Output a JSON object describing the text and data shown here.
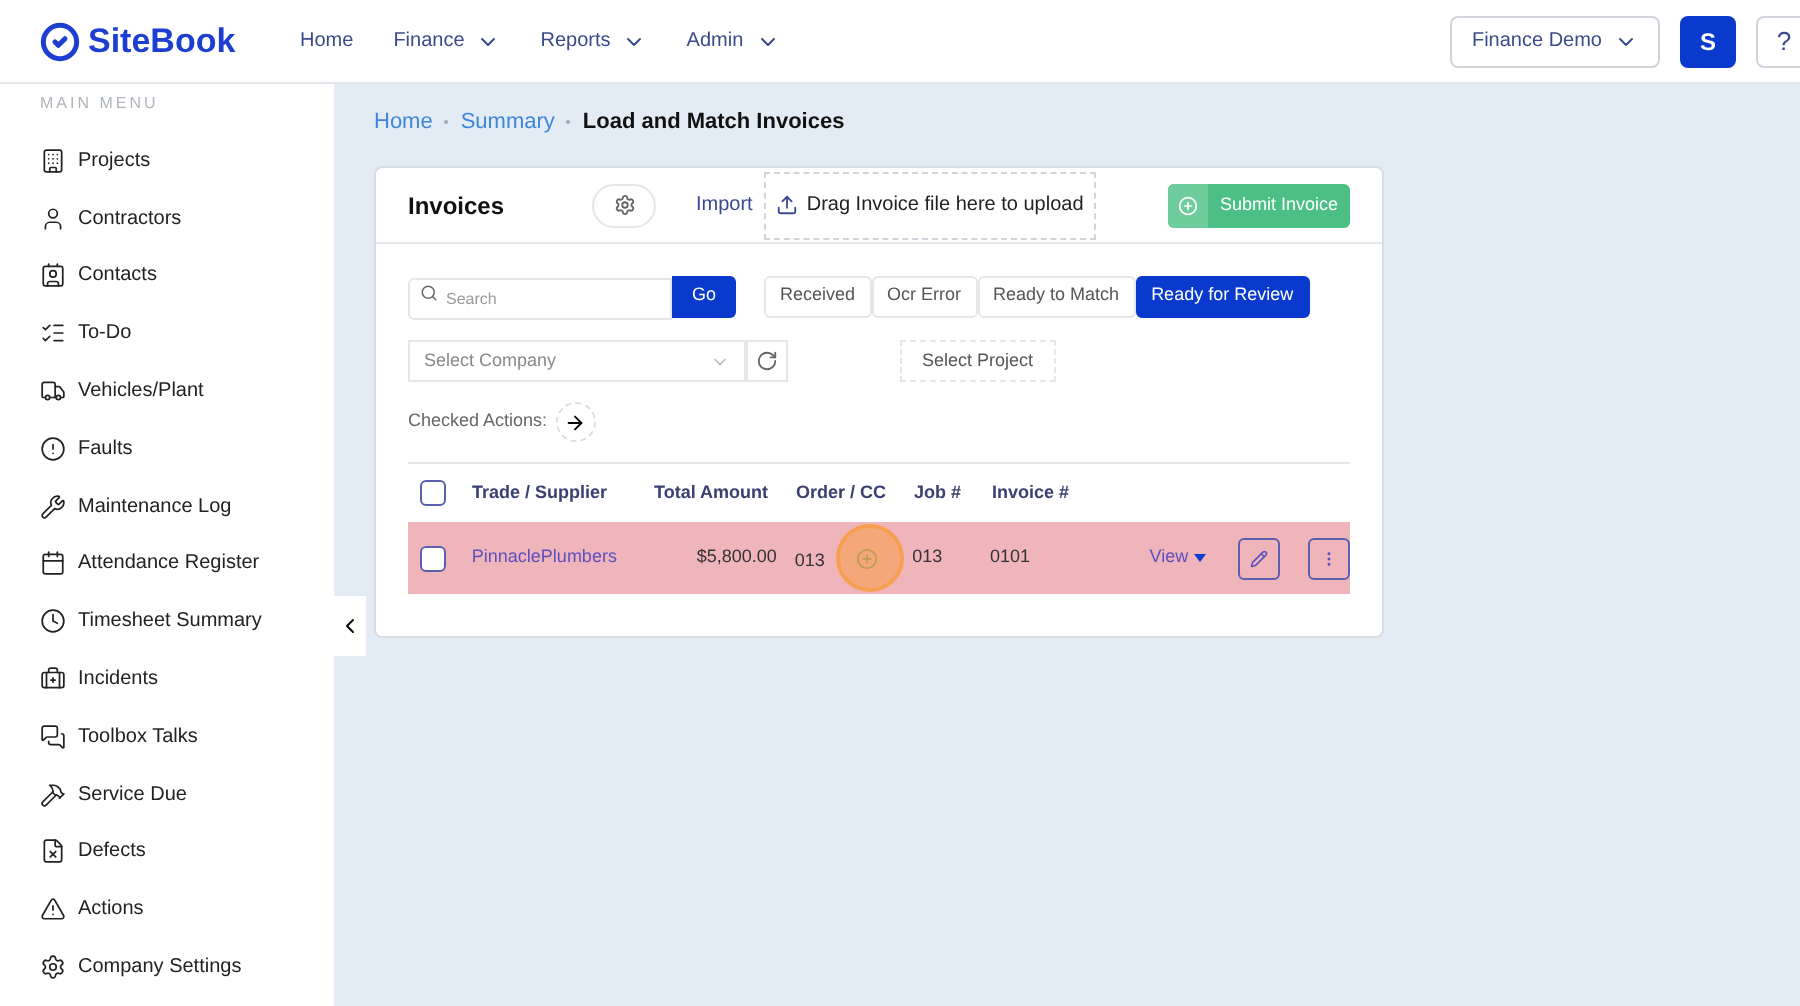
{
  "header": {
    "logo": "SiteBook",
    "nav": [
      {
        "label": "Home",
        "dropdown": false
      },
      {
        "label": "Finance",
        "dropdown": true
      },
      {
        "label": "Reports",
        "dropdown": true
      },
      {
        "label": "Admin",
        "dropdown": true
      }
    ],
    "account": "Finance Demo",
    "avatar": "S",
    "help": "?"
  },
  "sidebar": {
    "heading": "MAIN MENU",
    "items": [
      {
        "label": "Projects"
      },
      {
        "label": "Contractors"
      },
      {
        "label": "Contacts"
      },
      {
        "label": "To-Do"
      },
      {
        "label": "Vehicles/Plant"
      },
      {
        "label": "Faults"
      },
      {
        "label": "Maintenance Log"
      },
      {
        "label": "Attendance Register"
      },
      {
        "label": "Timesheet Summary"
      },
      {
        "label": "Incidents"
      },
      {
        "label": "Toolbox Talks"
      },
      {
        "label": "Service Due"
      },
      {
        "label": "Defects"
      },
      {
        "label": "Actions"
      },
      {
        "label": "Company Settings"
      }
    ]
  },
  "breadcrumb": [
    {
      "label": "Home",
      "current": false
    },
    {
      "label": "Summary",
      "current": false
    },
    {
      "label": "Load and Match Invoices",
      "current": true
    }
  ],
  "card": {
    "title": "Invoices",
    "import": "Import",
    "upload": "Drag Invoice file here to upload",
    "submit": "Submit Invoice",
    "search": {
      "placeholder": "Search",
      "button": "Go"
    },
    "filters": [
      {
        "label": "Received",
        "selected": false
      },
      {
        "label": "Ocr Error",
        "selected": false
      },
      {
        "label": "Ready to Match",
        "selected": false
      },
      {
        "label": "Ready for Review",
        "selected": true
      }
    ],
    "company": {
      "placeholder": "Select Company"
    },
    "project": "Select Project",
    "checked_actions": "Checked Actions:",
    "table": {
      "all_checked": false,
      "columns": [
        "Trade / Supplier",
        "Total Amount",
        "Order / CC",
        "Job #",
        "Invoice #"
      ],
      "rows": [
        {
          "checked": false,
          "highlighted": true,
          "supplier": "PinnaclePlumbers",
          "amount": "$5,800.00",
          "order": "013",
          "job": "013",
          "invoice": "0101",
          "view": "View"
        }
      ]
    }
  }
}
